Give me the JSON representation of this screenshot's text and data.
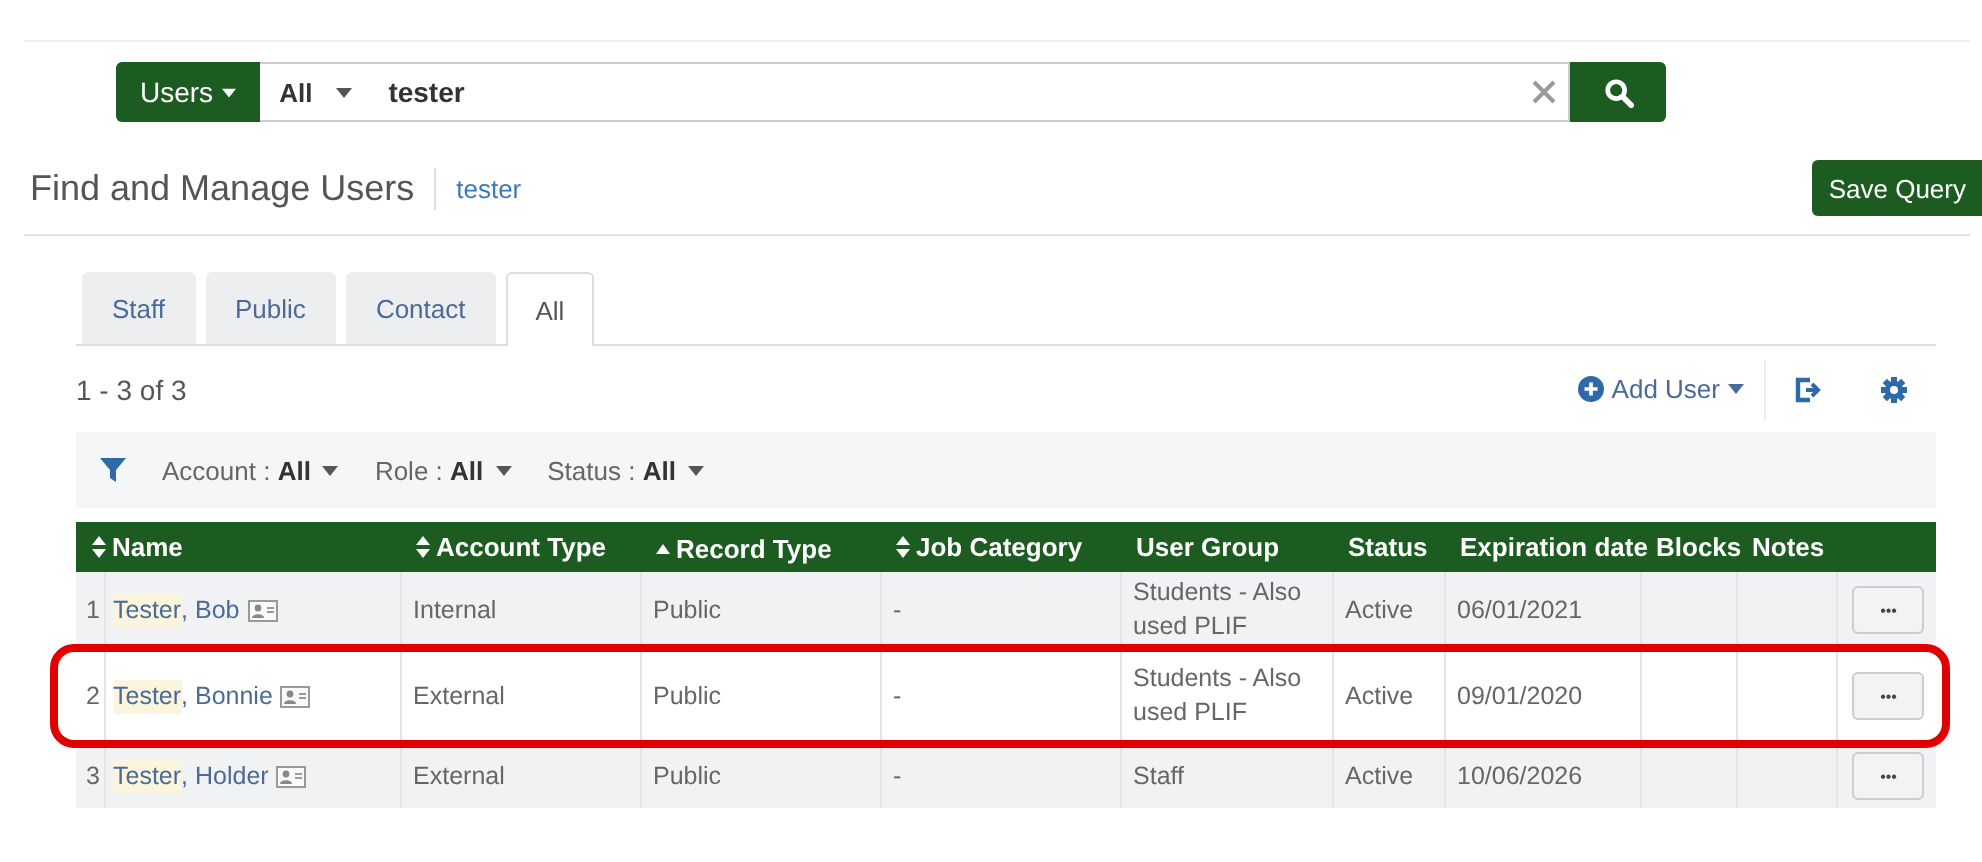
{
  "search": {
    "scope": "Users",
    "filter": "All",
    "value": "tester"
  },
  "page": {
    "title": "Find and Manage Users",
    "query": "tester",
    "save_button": "Save Query"
  },
  "tabs": [
    {
      "label": "Staff",
      "selected": false
    },
    {
      "label": "Public",
      "selected": false
    },
    {
      "label": "Contact",
      "selected": false
    },
    {
      "label": "All",
      "selected": true
    }
  ],
  "result_count": "1 - 3 of 3",
  "add_user": "Add User",
  "filters": [
    "Account : **All**",
    "Role : **All**",
    "Status : **All**"
  ],
  "table": {
    "columns": [
      {
        "label": "Name",
        "kind": "sortable"
      },
      {
        "label": "Account Type",
        "kind": "sortable"
      },
      {
        "label": "Record Type",
        "kind": "ascending"
      },
      {
        "label": "Job Category",
        "kind": "sortable"
      },
      {
        "label": "User Group",
        "kind": "plain"
      },
      {
        "label": "Status",
        "kind": "plain"
      },
      {
        "label": "Expiration date",
        "kind": "plain"
      },
      {
        "label": "Blocks",
        "kind": "plain"
      },
      {
        "label": "Notes",
        "kind": "plain"
      }
    ],
    "rows": [
      {
        "number": "1",
        "name_parts": [
          {
            "text": "Tester",
            "match": true
          },
          {
            "text": ", Bob",
            "match": false
          }
        ],
        "account_type": "Internal",
        "record_type": "Public",
        "job_category": "-",
        "user_group": "Students - Also used PLIF",
        "status": "Active",
        "expiration_date": "06/01/2021",
        "actions": "•••",
        "highlighted": false
      },
      {
        "number": "2",
        "name_parts": [
          {
            "text": "Tester",
            "match": true
          },
          {
            "text": ", Bonnie",
            "match": false
          }
        ],
        "account_type": "External",
        "record_type": "Public",
        "job_category": "-",
        "user_group": "Students - Also used PLIF",
        "status": "Active",
        "expiration_date": "09/01/2020",
        "actions": "•••",
        "highlighted": true
      },
      {
        "number": "3",
        "name_parts": [
          {
            "text": "Tester",
            "match": true
          },
          {
            "text": ", Holder",
            "match": false
          }
        ],
        "account_type": "External",
        "record_type": "Public",
        "job_category": "-",
        "user_group": "Staff",
        "status": "Active",
        "expiration_date": "10/06/2026",
        "actions": "•••",
        "highlighted": false
      }
    ]
  }
}
